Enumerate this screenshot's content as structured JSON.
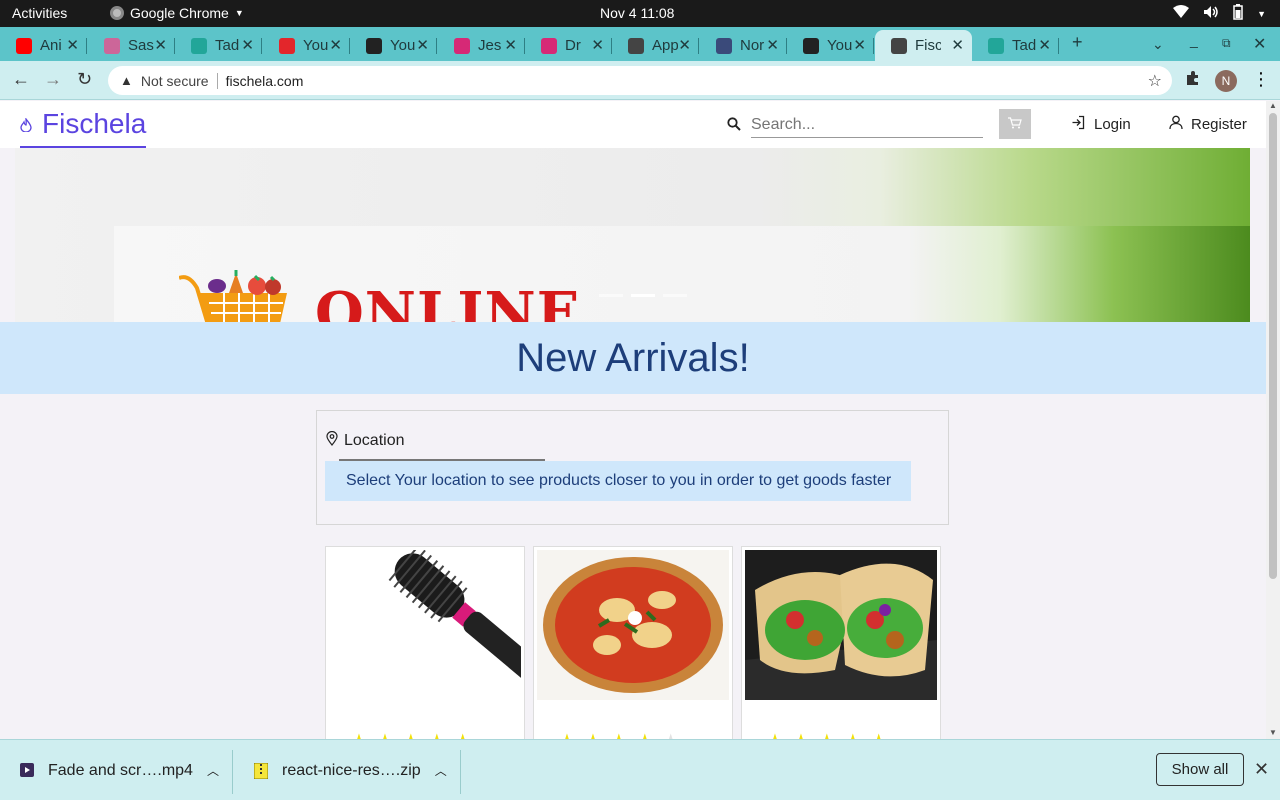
{
  "system_bar": {
    "activities": "Activities",
    "app_name": "Google Chrome",
    "clock": "Nov 4  11:08"
  },
  "tabs": [
    {
      "title": "Ani",
      "favicon": "youtube-icon",
      "color": "#ff0000"
    },
    {
      "title": "Sas",
      "favicon": "sass-icon",
      "color": "#cc6699"
    },
    {
      "title": "Tad",
      "favicon": "tad-icon",
      "color": "#22a699"
    },
    {
      "title": "You",
      "favicon": "download-icon",
      "color": "#e3262b"
    },
    {
      "title": "You",
      "favicon": "github-icon",
      "color": "#222222"
    },
    {
      "title": "Jes",
      "favicon": "instagram-icon",
      "color": "#d62976"
    },
    {
      "title": "Dr",
      "favicon": "instagram-icon",
      "color": "#d62976"
    },
    {
      "title": "App",
      "favicon": "globe-icon",
      "color": "#444444"
    },
    {
      "title": "Nor",
      "favicon": "t-icon",
      "color": "#3a4a7a"
    },
    {
      "title": "You",
      "favicon": "github-icon",
      "color": "#222222"
    },
    {
      "title": "Fisc",
      "favicon": "globe-icon",
      "color": "#444444",
      "active": true
    },
    {
      "title": "Tad",
      "favicon": "tad-icon",
      "color": "#22a699"
    }
  ],
  "address_bar": {
    "security_label": "Not secure",
    "url": "fischela.com",
    "profile_initial": "N"
  },
  "site": {
    "brand": "Fischela",
    "search_placeholder": "Search...",
    "login_label": "Login",
    "register_label": "Register",
    "hero_headline": "ONLINE",
    "carousel": {
      "slides": 3,
      "active_index": 1
    }
  },
  "new_arrivals": {
    "heading": "New Arrivals!"
  },
  "location": {
    "label": "Location",
    "message": "Select Your location to see products closer to you in order to get goods faster"
  },
  "products": [
    {
      "image": "hair-dryer-brush",
      "rating": 5,
      "max_rating": 5
    },
    {
      "image": "pizza",
      "rating": 4,
      "max_rating": 5
    },
    {
      "image": "burrito-wrap",
      "rating": 5,
      "max_rating": 5
    }
  ],
  "downloads": {
    "items": [
      {
        "name": "Fade and scr….mp4",
        "icon": "video-file-icon"
      },
      {
        "name": "react-nice-res….zip",
        "icon": "zip-file-icon"
      }
    ],
    "show_all_label": "Show all"
  },
  "colors": {
    "brand_purple": "#5b44e0",
    "chrome_teal": "#5cc4c9",
    "banner_blue": "#cfe7fb",
    "heading_navy": "#1d3e7a",
    "star_yellow": "#f2e10c"
  }
}
